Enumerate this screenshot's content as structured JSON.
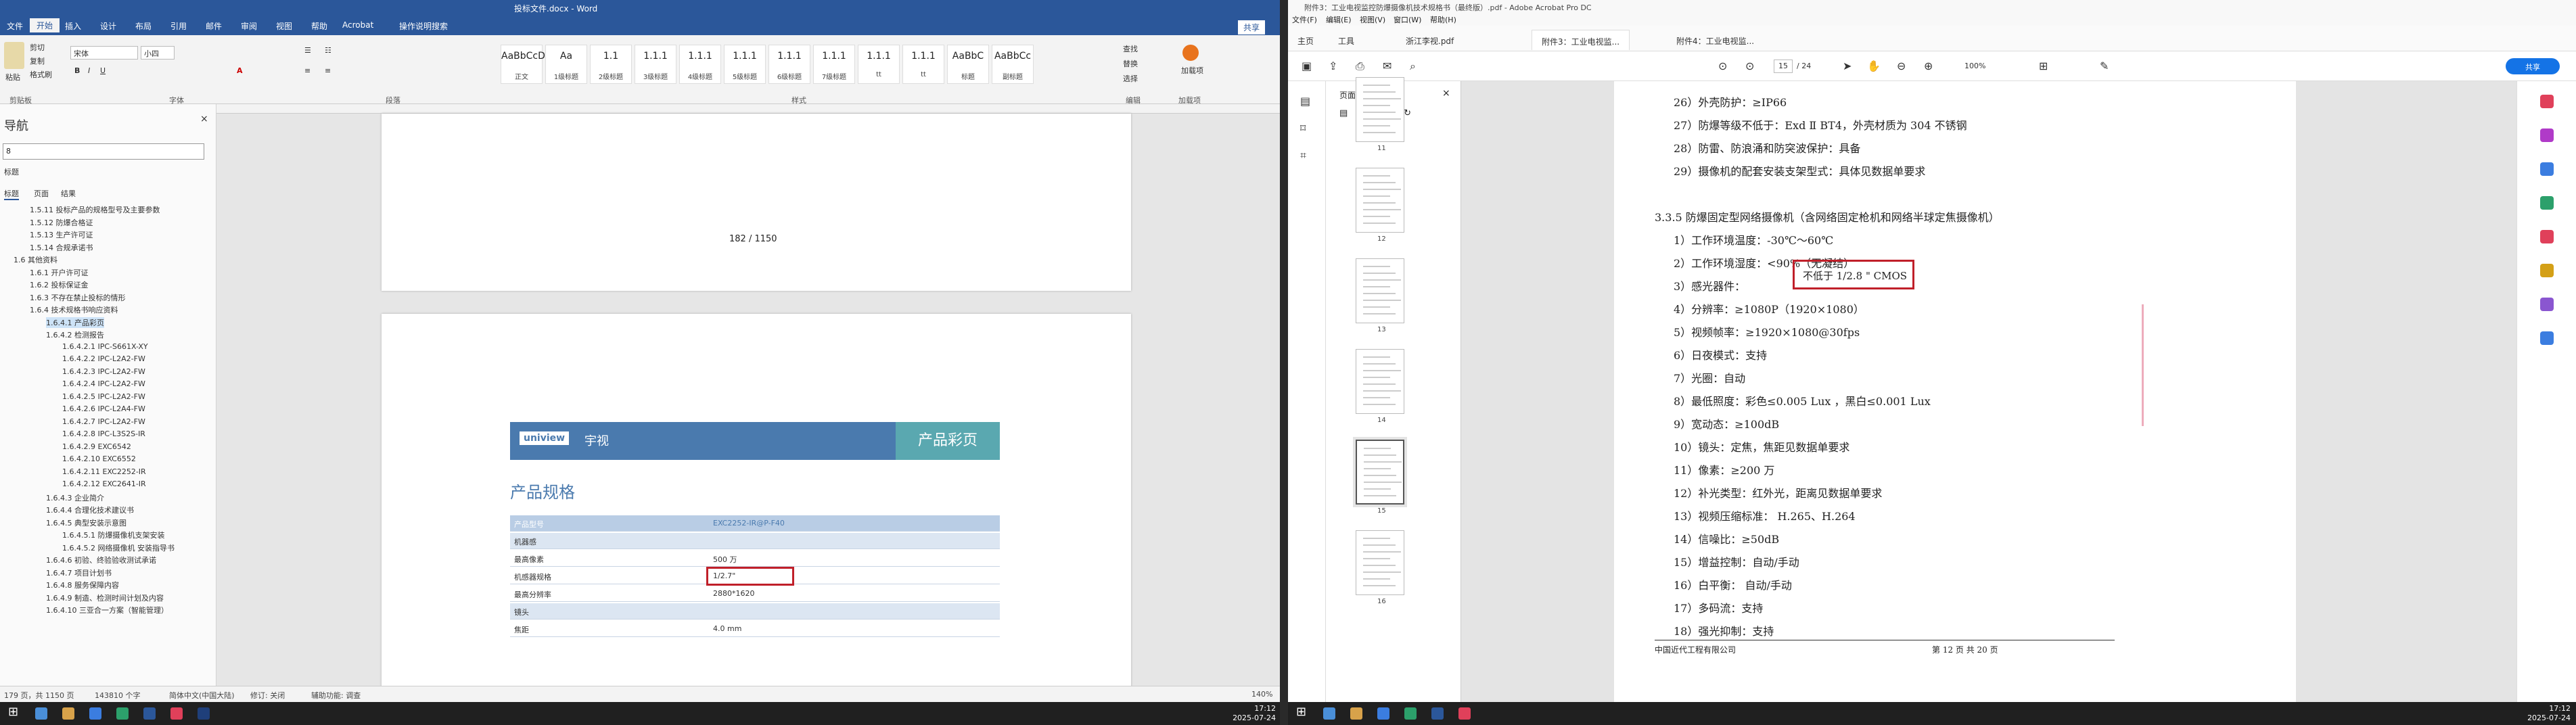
{
  "word": {
    "title": "投标文件.docx - Word",
    "tabs": [
      "文件",
      "开始",
      "插入",
      "设计",
      "布局",
      "引用",
      "邮件",
      "审阅",
      "视图",
      "帮助",
      "Acrobat",
      "操作说明搜索"
    ],
    "active_tab": "开始",
    "share": "共享",
    "ribbon": {
      "paste": "粘贴",
      "cut": "剪切",
      "copy": "复制",
      "format_painter": "格式刷",
      "font_name": "宋体",
      "font_size": "小四",
      "groups": [
        "剪贴板",
        "字体",
        "段落",
        "样式",
        "编辑",
        "加载项"
      ],
      "styles": [
        {
          "sample": "AaBbCcD",
          "name": "正文"
        },
        {
          "sample": "Aa",
          "name": "1级标题"
        },
        {
          "sample": "1.1",
          "name": "2级标题"
        },
        {
          "sample": "1.1.1",
          "name": "3级标题"
        },
        {
          "sample": "1.1.1",
          "name": "4级标题"
        },
        {
          "sample": "1.1.1",
          "name": "5级标题"
        },
        {
          "sample": "1.1.1",
          "name": "6级标题"
        },
        {
          "sample": "1.1.1",
          "name": "7级标题"
        },
        {
          "sample": "1.1.1",
          "name": "tt"
        },
        {
          "sample": "1.1.1",
          "name": "tt"
        },
        {
          "sample": "AaBbC",
          "name": "标题"
        },
        {
          "sample": "AaBbCc",
          "name": "副标题"
        }
      ],
      "find": "查找",
      "replace": "替换",
      "select": "选择",
      "addin": "加载项"
    },
    "nav": {
      "title": "导航",
      "search_value": "8",
      "subtitle": "标题",
      "tabs": [
        "标题",
        "页面",
        "结果"
      ],
      "items": [
        "1.5.11 投标产品的规格型号及主要参数",
        "1.5.12 防爆合格证",
        "1.5.13 生产许可证",
        "1.5.14 合规承诺书",
        "1.6 其他资料",
        "1.6.1 开户许可证",
        "1.6.2 投标保证金",
        "1.6.3 不存在禁止投标的情形",
        "1.6.4 技术规格书响应资料",
        "1.6.4.1 产品彩页",
        "1.6.4.2 检测报告",
        "1.6.4.2.1 IPC-S661X-XY",
        "1.6.4.2.2 IPC-L2A2-FW",
        "1.6.4.2.3 IPC-L2A2-FW",
        "1.6.4.2.4 IPC-L2A2-FW",
        "1.6.4.2.5 IPC-L2A2-FW",
        "1.6.4.2.6 IPC-L2A4-FW",
        "1.6.4.2.7 IPC-L2A2-FW",
        "1.6.4.2.8 IPC-L3S2S-IR",
        "1.6.4.2.9 EXC6542",
        "1.6.4.2.10 EXC6552",
        "1.6.4.2.11 EXC2252-IR",
        "1.6.4.2.12 EXC2641-IR",
        "1.6.4.3 企业简介",
        "1.6.4.4 合理化技术建议书",
        "1.6.4.5 典型安装示意图",
        "1.6.4.5.1 防爆摄像机支架安装",
        "1.6.4.5.2 网络摄像机 安装指导书",
        "1.6.4.6 初验、终验验收测试承诺",
        "1.6.4.7 项目计划书",
        "1.6.4.8 服务保障内容",
        "1.6.4.9 制造、检测时间计划及内容",
        "1.6.4.10 三亚合一方案（智能管理）"
      ],
      "selected_index": 9
    },
    "page1_footer": "182 / 1150",
    "brochure": {
      "logo": "uniview",
      "brand": "宇视",
      "banner": "产品彩页",
      "heading": "产品规格",
      "rows": [
        {
          "k": "产品型号",
          "v": "EXC2252-IR@P-F40",
          "head": true
        },
        {
          "k": "机器感",
          "v": "",
          "sec": true
        },
        {
          "k": "最高像素",
          "v": "500 万"
        },
        {
          "k": "机感器规格",
          "v": "1/2.7\"",
          "hl": true
        },
        {
          "k": "最高分辨率",
          "v": "2880*1620"
        },
        {
          "k": "镜头",
          "v": "",
          "sec": true
        },
        {
          "k": "焦距",
          "v": "4.0 mm"
        }
      ]
    },
    "status": {
      "page": "179 页，共 1150 页",
      "words": "143810 个字",
      "lang": "简体中文(中国大陆)",
      "track": "修订: 关闭",
      "access": "辅助功能: 调查",
      "zoom": "140%"
    }
  },
  "acrobat": {
    "title": "附件3：工业电视监控防爆摄像机技术规格书（最终版）.pdf - Adobe Acrobat Pro DC",
    "menu": [
      "文件(F)",
      "编辑(E)",
      "视图(V)",
      "窗口(W)",
      "帮助(H)"
    ],
    "tabs": [
      "主页",
      "工具",
      "浙江李视.pdf",
      "附件3：工业电视监...",
      "附件4：工业电视监..."
    ],
    "page_current": "15",
    "page_total": "/ 24",
    "zoom": "100%",
    "share": "共享",
    "thumb_panel": "页面缩略图",
    "thumb_labels": [
      "11",
      "12",
      "13",
      "14",
      "15",
      "16"
    ],
    "thumb_selected": "15",
    "lines": [
      "26）外壳防护：≥IP66",
      "27）防爆等级不低于：Exd Ⅱ BT4，外壳材质为 304 不锈钢",
      "28）防雷、防浪涌和防突波保护：具备",
      "29）摄像机的配套安装支架型式：具体见数据单要求",
      "",
      "3.3.5  防爆固定型网络摄像机（含网络固定枪机和网络半球定焦摄像机）",
      "1）工作环境温度：-30℃～60℃",
      "2）工作环境湿度：<90%（无凝结）",
      "3）感光器件：",
      "4）分辨率：≥1080P（1920×1080）",
      "5）视频帧率：≥1920×1080@30fps",
      "6）日夜模式：支持",
      "7）光圈：自动",
      "8）最低照度：彩色≤0.005 Lux ，黑白≤0.001 Lux",
      "9）宽动态：≥100dB",
      "10）镜头：定焦，焦距见数据单要求",
      "11）像素：≥200 万",
      "12）补光类型：红外光，距离见数据单要求",
      "13）视频压缩标准：  H.265、H.264",
      "14）信噪比：≥50dB",
      "15）增益控制：自动/手动",
      "16）白平衡：  自动/手动",
      "17）多码流：支持",
      "18）强光抑制：支持"
    ],
    "highlight": "不低于 1/2.8 \" CMOS",
    "footer_left": "中国近代工程有限公司",
    "footer_right": "第  12  页  共 20 页"
  },
  "taskbar": {
    "time_left": "17:12",
    "date_left": "2025-07-24",
    "time_right": "17:12",
    "date_right": "2025-07-24"
  },
  "colors": {
    "word_blue": "#2b579a",
    "acro_red": "#c0202a",
    "brochure_blue": "#4a7aae",
    "brochure_teal": "#5aa8b0"
  }
}
